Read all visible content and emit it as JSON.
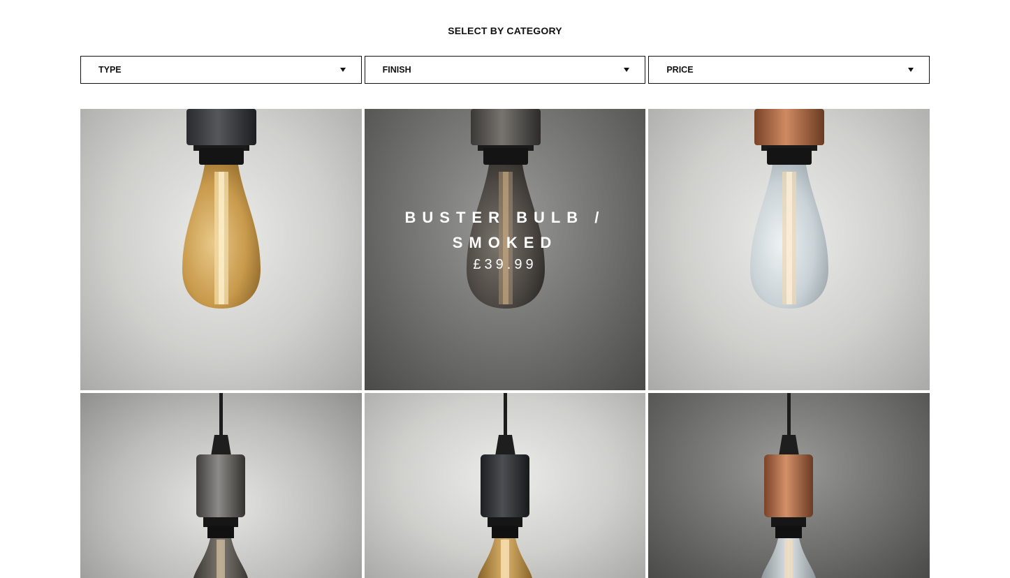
{
  "heading": "SELECT BY CATEGORY",
  "filters": [
    {
      "label": "TYPE",
      "icon": "caret-down-icon"
    },
    {
      "label": "FINISH",
      "icon": "caret-down-icon"
    },
    {
      "label": "PRICE",
      "icon": "caret-down-icon"
    }
  ],
  "hover_product": {
    "title": "BUSTER BULB / SMOKED",
    "price": "£39.99"
  },
  "colors": {
    "border": "#111111",
    "overlay_text": "#ffffff",
    "gold_glass": "#c89a4c",
    "smoked_glass": "#5a5550",
    "clear_glass": "#c9d2d6",
    "copper": "#b8704a",
    "graphite": "#3a3c40",
    "gunmetal": "#6b6a68"
  }
}
